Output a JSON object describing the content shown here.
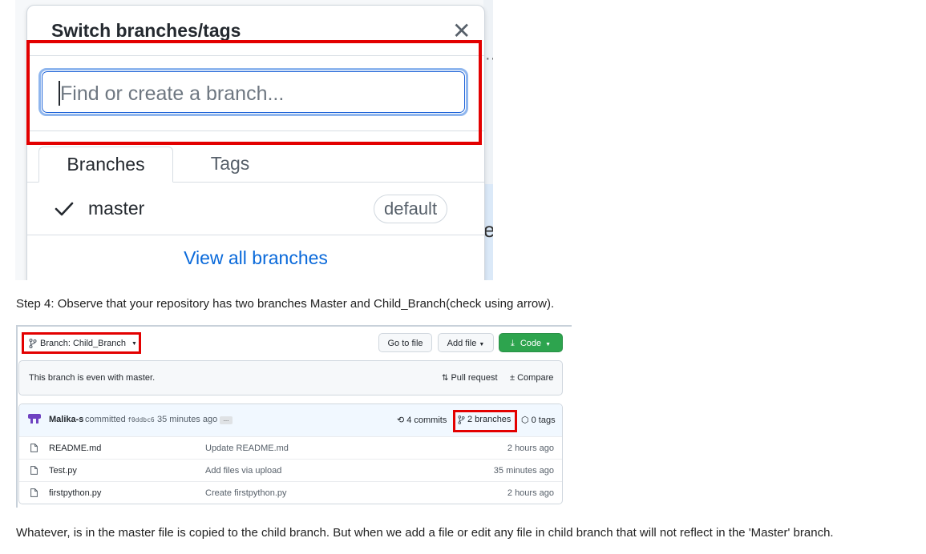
{
  "dropdown": {
    "title": "Switch branches/tags",
    "search_placeholder": "Find or create a branch...",
    "tabs": [
      {
        "label": "Branches",
        "active": true
      },
      {
        "label": "Tags",
        "active": false
      }
    ],
    "branches": [
      {
        "name": "master",
        "checked": true,
        "badge": "default"
      }
    ],
    "view_all_label": "View all branches",
    "colors": {
      "link": "#0969da",
      "highlight": "#e30000"
    }
  },
  "caption_step4": "Step 4: Observe that your repository has two branches Master and Child_Branch(check using arrow).",
  "repo": {
    "branch_button_label": "Branch: Child_Branch",
    "goto_file_label": "Go to file",
    "add_file_label": "Add file",
    "code_label": "Code",
    "status_text": "This branch is even with master.",
    "pull_request_label": "Pull request",
    "compare_label": "Compare",
    "commit": {
      "author": "Malika-s",
      "verb": "committed",
      "sha": "f0ddbc6",
      "time": "35 minutes ago",
      "more": "..."
    },
    "commits_label": "4 commits",
    "branches_label": "2 branches",
    "tags_label": "0 tags",
    "files": [
      {
        "name": "README.md",
        "message": "Update README.md",
        "age": "2 hours ago"
      },
      {
        "name": "Test.py",
        "message": "Add files via upload",
        "age": "35 minutes ago"
      },
      {
        "name": "firstpython.py",
        "message": "Create firstpython.py",
        "age": "2 hours ago"
      }
    ],
    "colors": {
      "code_button": "#2da44e",
      "commit_bar": "#f1f8ff"
    }
  },
  "caption_bottom": "Whatever, is in the master file is copied to the child branch. But when we add a file or edit any file in child branch that will not reflect in the 'Master' branch."
}
